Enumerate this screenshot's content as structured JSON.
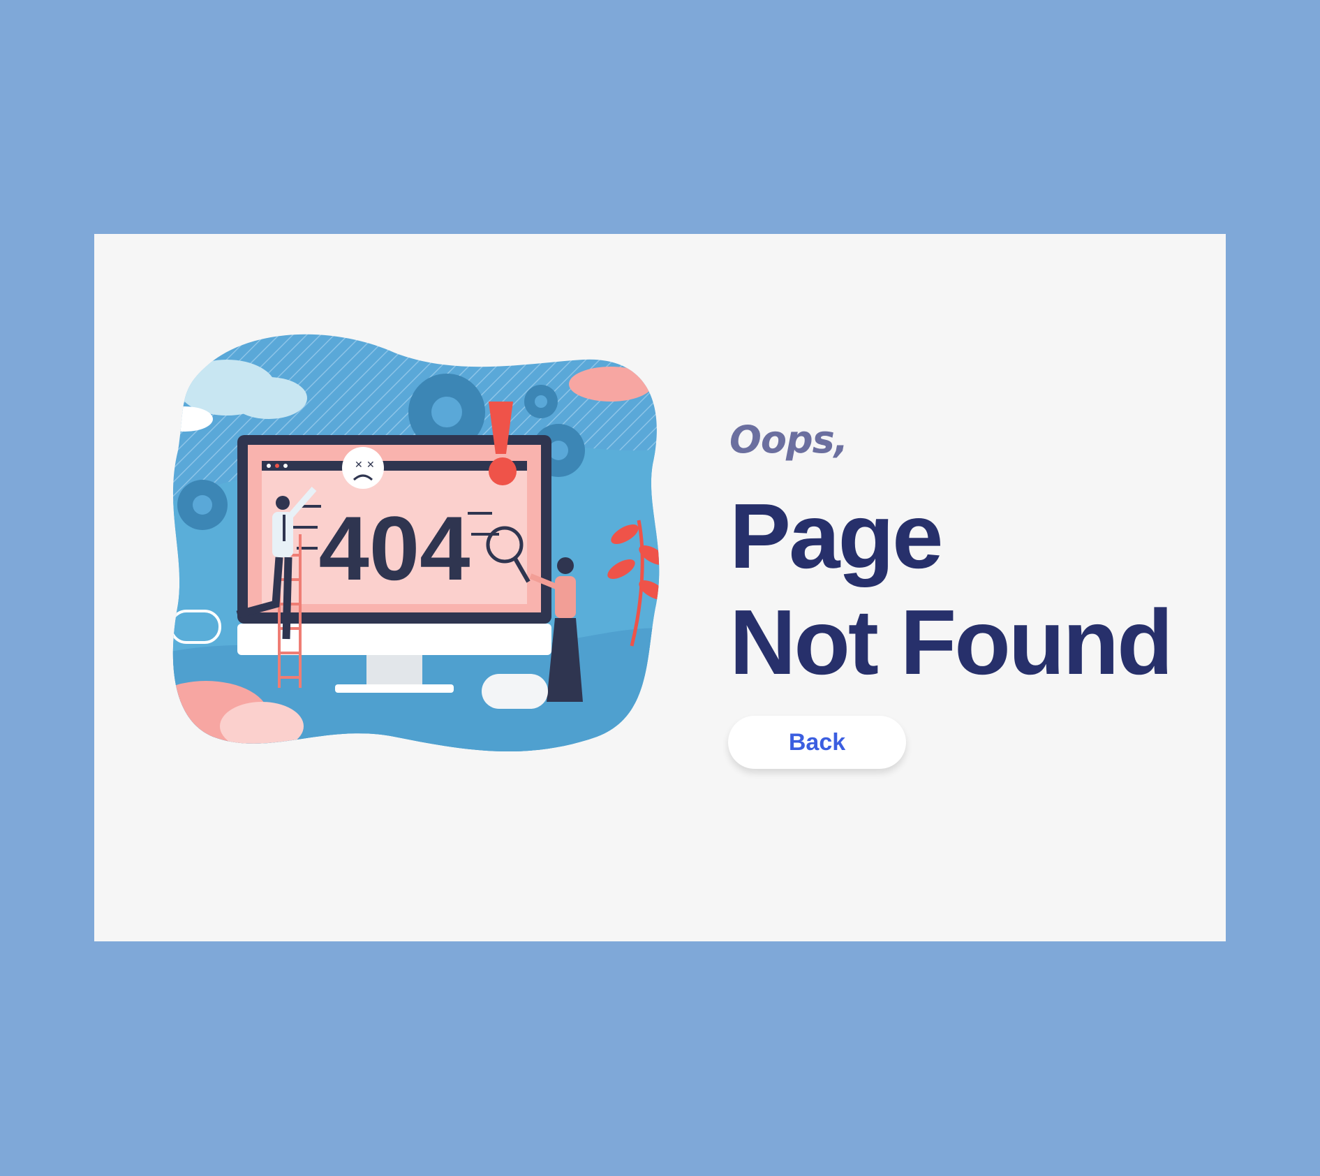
{
  "page": {
    "background_color": "#7fa8d8",
    "card_color": "#f6f6f6"
  },
  "illustration": {
    "screen_text": "404",
    "icons": [
      "gear-icon",
      "magnifier-icon",
      "exclamation-icon",
      "sad-face-icon",
      "ladder-icon",
      "cloud-icon",
      "plant-icon",
      "mouse-icon"
    ]
  },
  "message": {
    "oops": "Oops,",
    "line1": "Page",
    "line2": "Not Found"
  },
  "back_button": {
    "label": "Back"
  },
  "colors": {
    "heading": "#27306b",
    "oops": "#6b6f9f",
    "button_text": "#3b5ee0",
    "illustration_blue": "#5aa8d8",
    "screen_pink": "#f9b3ae",
    "accent_red": "#ef5349"
  }
}
